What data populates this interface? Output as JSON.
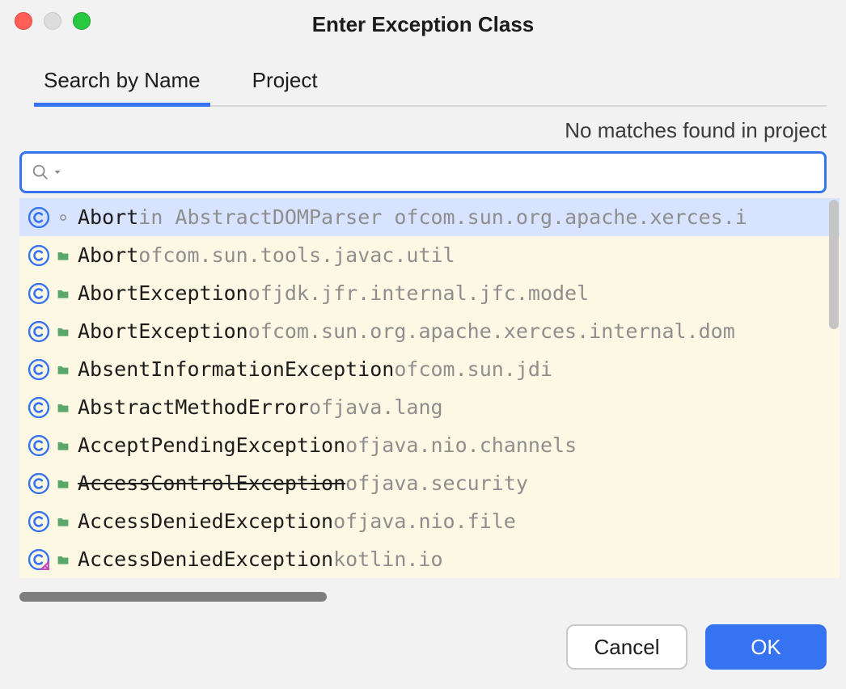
{
  "title": "Enter Exception Class",
  "tabs": [
    {
      "label": "Search by Name",
      "active": true
    },
    {
      "label": "Project",
      "active": false
    }
  ],
  "status": "No matches found in project",
  "search": {
    "value": "",
    "placeholder": ""
  },
  "results": [
    {
      "selected": true,
      "icon": "class",
      "sub": "dot",
      "name": "Abort",
      "pre": " in AbstractDOMParser of ",
      "pkg": "com.sun.org.apache.xerces.i",
      "strike": false
    },
    {
      "selected": false,
      "icon": "class",
      "sub": "folder",
      "name": "Abort",
      "pre": " of ",
      "pkg": "com.sun.tools.javac.util",
      "strike": false
    },
    {
      "selected": false,
      "icon": "class",
      "sub": "folder",
      "name": "AbortException",
      "pre": " of ",
      "pkg": "jdk.jfr.internal.jfc.model",
      "strike": false
    },
    {
      "selected": false,
      "icon": "class",
      "sub": "folder",
      "name": "AbortException",
      "pre": " of ",
      "pkg": "com.sun.org.apache.xerces.internal.dom",
      "strike": false
    },
    {
      "selected": false,
      "icon": "class",
      "sub": "folder",
      "name": "AbsentInformationException",
      "pre": " of ",
      "pkg": "com.sun.jdi",
      "strike": false
    },
    {
      "selected": false,
      "icon": "class",
      "sub": "folder",
      "name": "AbstractMethodError",
      "pre": " of ",
      "pkg": "java.lang",
      "strike": false
    },
    {
      "selected": false,
      "icon": "class",
      "sub": "folder",
      "name": "AcceptPendingException",
      "pre": " of ",
      "pkg": "java.nio.channels",
      "strike": false
    },
    {
      "selected": false,
      "icon": "class",
      "sub": "folder",
      "name": "AccessControlException",
      "pre": " of ",
      "pkg": "java.security",
      "strike": true
    },
    {
      "selected": false,
      "icon": "class",
      "sub": "folder",
      "name": "AccessDeniedException",
      "pre": " of ",
      "pkg": "java.nio.file",
      "strike": false
    },
    {
      "selected": false,
      "icon": "kotlin-class",
      "sub": "folder",
      "name": "AccessDeniedException",
      "pre": " ",
      "pkg": "kotlin.io",
      "strike": false
    }
  ],
  "buttons": {
    "cancel": "Cancel",
    "ok": "OK"
  },
  "colors": {
    "accent": "#3573f0",
    "listBg": "#fdf8e3",
    "selectedBg": "#d7e3ff"
  }
}
